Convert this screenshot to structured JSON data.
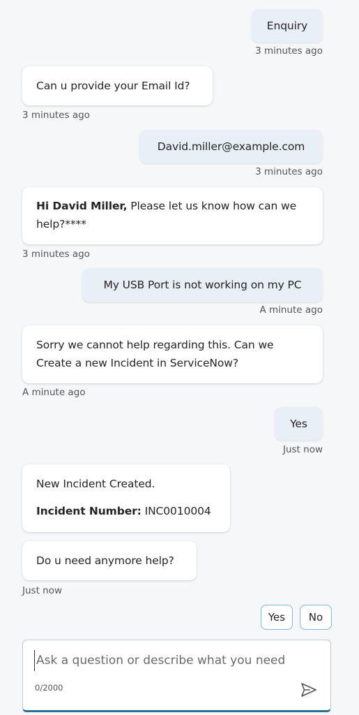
{
  "messages": [
    {
      "sender": "user",
      "text": "Enquiry",
      "time": "3 minutes ago"
    },
    {
      "sender": "bot",
      "text": "Can u provide your Email Id?",
      "time": "3 minutes ago"
    },
    {
      "sender": "user",
      "text": "David.miller@example.com",
      "time": "3 minutes ago"
    },
    {
      "sender": "bot",
      "bold_prefix": "Hi David Miller,",
      "text_line1": " Please let us know how can we",
      "text_line2": "help?****",
      "time": "3 minutes ago"
    },
    {
      "sender": "user",
      "text": "My USB Port is not working on my PC",
      "time": "A minute ago"
    },
    {
      "sender": "bot",
      "text_line1": "Sorry we cannot help regarding this. Can we",
      "text_line2": "Create a new Incident in ServiceNow?",
      "time": "A minute ago"
    },
    {
      "sender": "user",
      "text": "Yes",
      "time": "Just now"
    },
    {
      "sender": "bot",
      "line1": "New Incident Created.",
      "bold_label": "Incident Number:",
      "value": " INC0010004"
    },
    {
      "sender": "bot",
      "text": "Do u need anymore help?",
      "time": "Just now"
    }
  ],
  "quick_replies": [
    "Yes",
    "No"
  ],
  "composer": {
    "placeholder": "Ask a question or describe what you need",
    "counter": "0/2000",
    "send_icon": "send-icon"
  },
  "colors": {
    "background": "#f6f7f9",
    "user_bubble": "#e9eff7",
    "bot_bubble": "#ffffff",
    "accent": "#2b6f95",
    "quick_reply_border": "#7fb8d8"
  }
}
